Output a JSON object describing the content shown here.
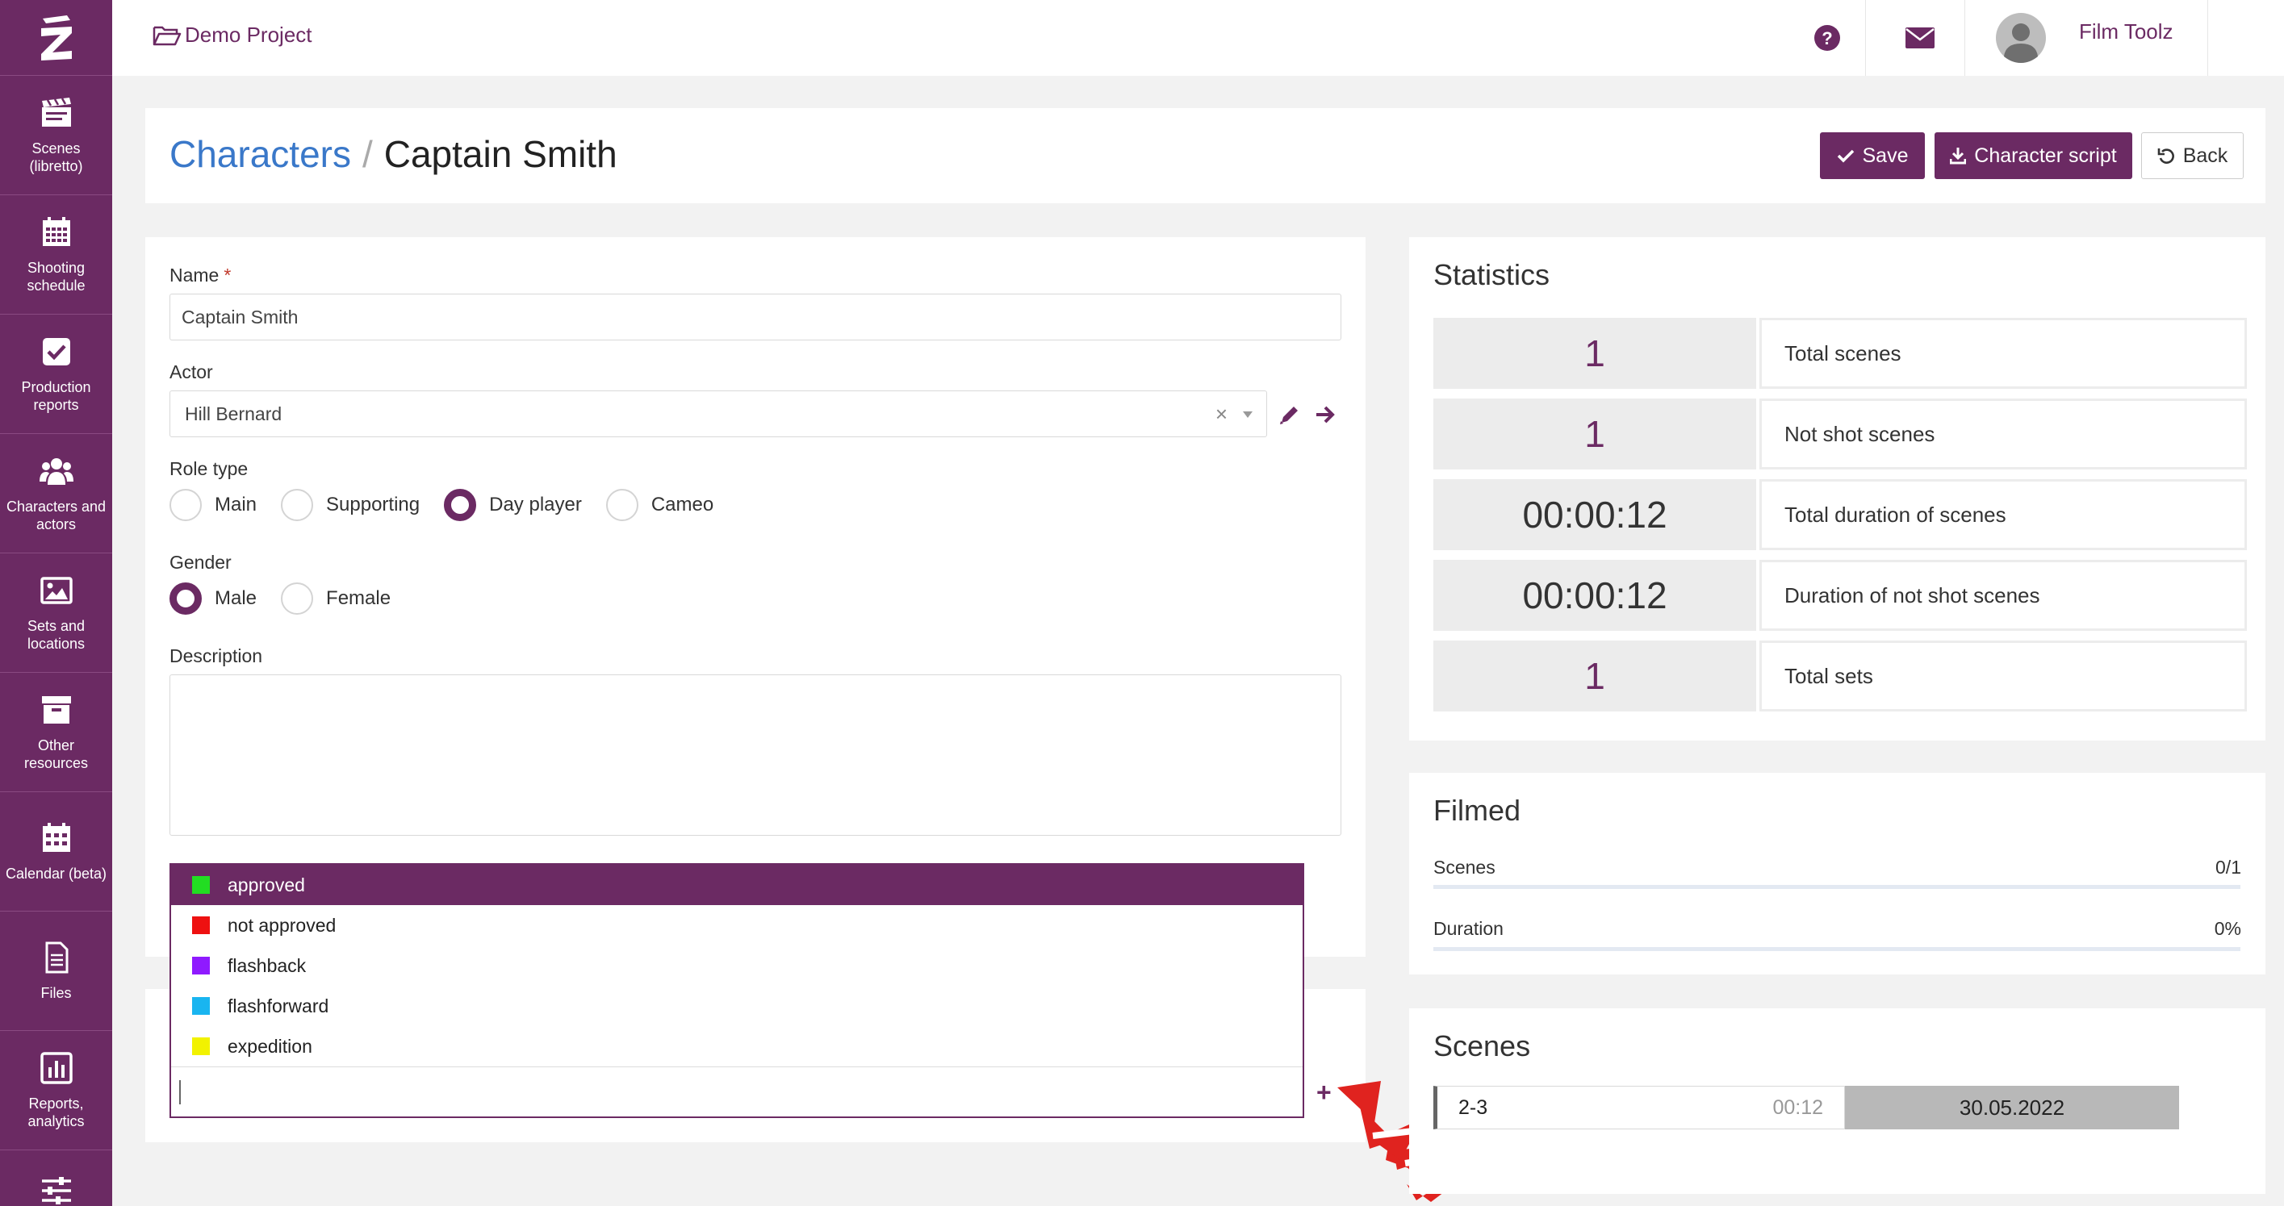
{
  "app": {
    "project": "Demo Project",
    "user": "Film Toolz",
    "language": "EN"
  },
  "sidebar": {
    "items": [
      {
        "label": "Scenes (libretto)",
        "icon": "clapperboard-icon"
      },
      {
        "label": "Shooting schedule",
        "icon": "calendar-grid-icon"
      },
      {
        "label": "Production reports",
        "icon": "checkbox-icon"
      },
      {
        "label": "Characters and actors",
        "icon": "users-icon"
      },
      {
        "label": "Sets and locations",
        "icon": "image-icon"
      },
      {
        "label": "Other resources",
        "icon": "archive-box-icon"
      },
      {
        "label": "Calendar (beta)",
        "icon": "calendar-icon"
      },
      {
        "label": "Files",
        "icon": "file-icon"
      },
      {
        "label": "Reports, analytics",
        "icon": "bar-chart-icon"
      },
      {
        "label": "",
        "icon": "sliders-icon"
      }
    ]
  },
  "header": {
    "breadcrumb_parent": "Characters",
    "breadcrumb_sep": "/",
    "title": "Captain Smith",
    "save_label": "Save",
    "script_label": "Character script",
    "back_label": "Back"
  },
  "form": {
    "name_label": "Name",
    "required_mark": "*",
    "name_value": "Captain Smith",
    "actor_label": "Actor",
    "actor_value": "Hill Bernard",
    "clear_mark": "×",
    "role_label": "Role type",
    "role_options": [
      "Main",
      "Supporting",
      "Day player",
      "Cameo"
    ],
    "role_selected": "Day player",
    "gender_label": "Gender",
    "gender_options": [
      "Male",
      "Female"
    ],
    "gender_selected": "Male",
    "description_label": "Description",
    "description_value": ""
  },
  "dropdown": {
    "items": [
      {
        "label": "approved",
        "color": "#22dd22"
      },
      {
        "label": "not approved",
        "color": "#ee1111"
      },
      {
        "label": "flashback",
        "color": "#8f1aff"
      },
      {
        "label": "flashforward",
        "color": "#19b5f0"
      },
      {
        "label": "expedition",
        "color": "#f2f200"
      }
    ],
    "active_index": 0,
    "plus_label": "+"
  },
  "statistics": {
    "title": "Statistics",
    "rows": [
      {
        "value": "1",
        "label": "Total scenes"
      },
      {
        "value": "1",
        "label": "Not shot scenes"
      },
      {
        "value": "00:00:12",
        "label": "Total duration of scenes"
      },
      {
        "value": "00:00:12",
        "label": "Duration of not shot scenes"
      },
      {
        "value": "1",
        "label": "Total sets"
      }
    ]
  },
  "filmed": {
    "title": "Filmed",
    "scenes_label": "Scenes",
    "scenes_value": "0/1",
    "scenes_fraction": 0,
    "duration_label": "Duration",
    "duration_value": "0%",
    "duration_fraction": 0
  },
  "scenes": {
    "title": "Scenes",
    "items": [
      {
        "number": "2-3",
        "duration": "00:12",
        "date": "30.05.2022"
      }
    ]
  },
  "colors": {
    "brand": "#6b2a63",
    "link": "#3a78c9",
    "arrow": "#e0231f"
  }
}
